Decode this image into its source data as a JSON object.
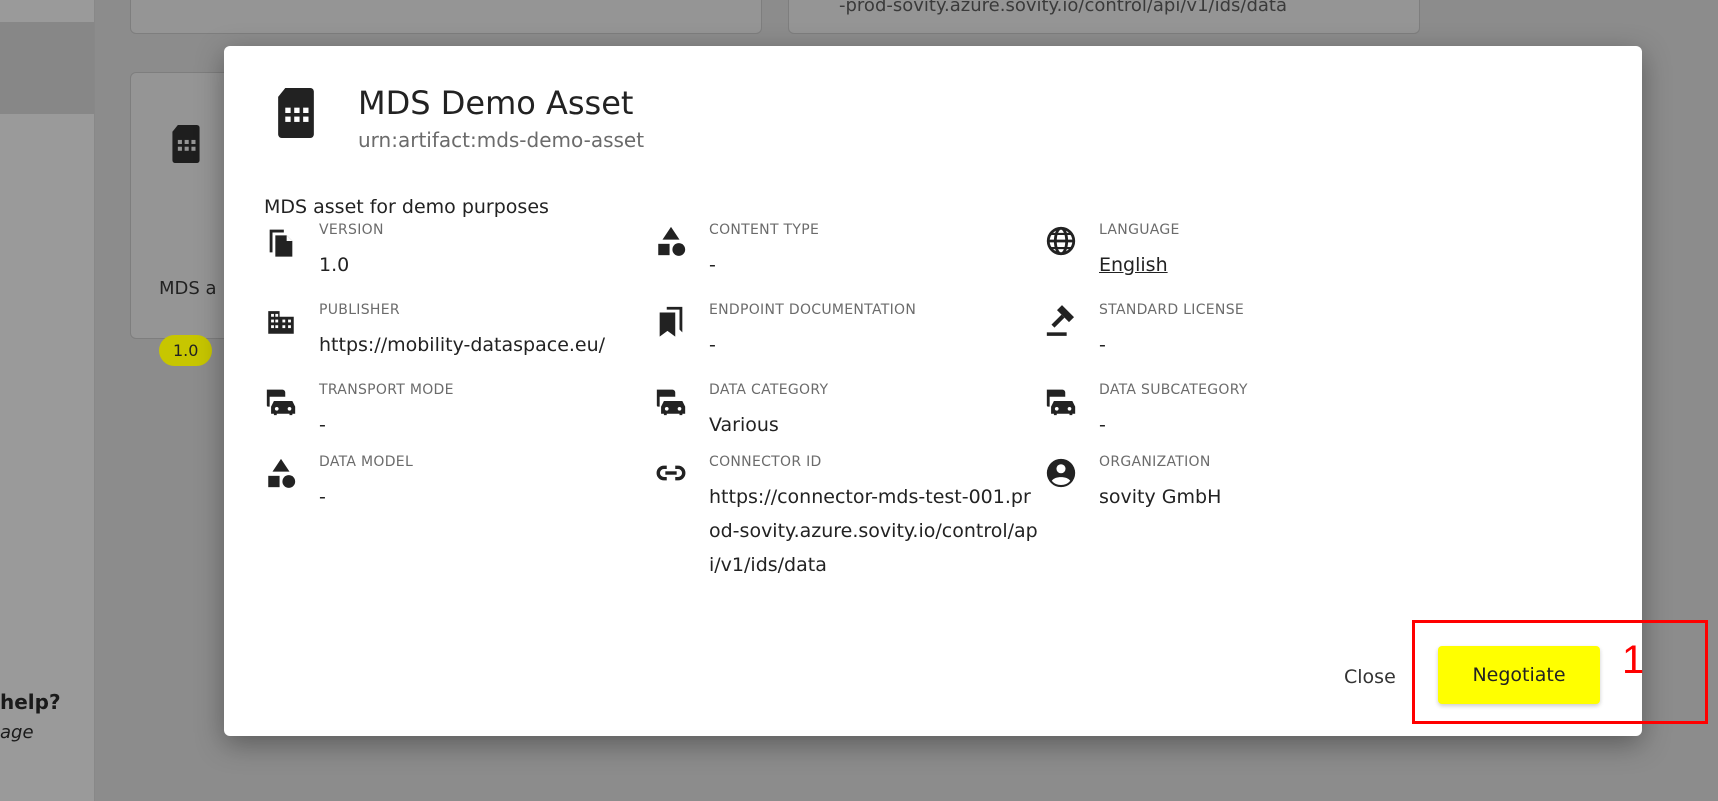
{
  "background": {
    "help_title": "help?",
    "help_sub": "age",
    "top_card_text": "-prod-sovity.azure.sovity.io/control/api/v1/ids/data",
    "card_text": "MDS a",
    "card_badge": "1.0"
  },
  "dialog": {
    "title": "MDS Demo Asset",
    "subtitle": "urn:artifact:mds-demo-asset",
    "description": "MDS asset for demo purposes",
    "fields": {
      "version": {
        "label": "VERSION",
        "value": "1.0",
        "icon": "file-copy-icon"
      },
      "content_type": {
        "label": "CONTENT TYPE",
        "value": "-",
        "icon": "category-shapes-icon"
      },
      "language": {
        "label": "LANGUAGE",
        "value": "English",
        "icon": "globe-icon"
      },
      "publisher": {
        "label": "PUBLISHER",
        "value": "https://mobility-dataspace.eu/",
        "icon": "building-icon"
      },
      "endpoint_documentation": {
        "label": "ENDPOINT DOCUMENTATION",
        "value": "-",
        "icon": "bookmarks-icon"
      },
      "standard_license": {
        "label": "STANDARD LICENSE",
        "value": "-",
        "icon": "gavel-icon"
      },
      "transport_mode": {
        "label": "TRANSPORT MODE",
        "value": "-",
        "icon": "commute-icon"
      },
      "data_category": {
        "label": "DATA CATEGORY",
        "value": "Various",
        "icon": "commute-icon"
      },
      "data_subcategory": {
        "label": "DATA SUBCATEGORY",
        "value": "-",
        "icon": "commute-icon"
      },
      "data_model": {
        "label": "DATA MODEL",
        "value": "-",
        "icon": "category-shapes-icon"
      },
      "connector_id": {
        "label": "CONNECTOR ID",
        "value": "https://connector-mds-test-001.prod-sovity.azure.sovity.io/control/api/v1/ids/data",
        "icon": "link-icon"
      },
      "organization": {
        "label": "ORGANIZATION",
        "value": "sovity GmbH",
        "icon": "account-circle-icon"
      }
    },
    "close_label": "Close",
    "negotiate_label": "Negotiate"
  },
  "annotation": {
    "number": "1",
    "color": "#ff0000"
  },
  "colors": {
    "accent": "#ffff00",
    "overlay": "#8c8c8c"
  }
}
